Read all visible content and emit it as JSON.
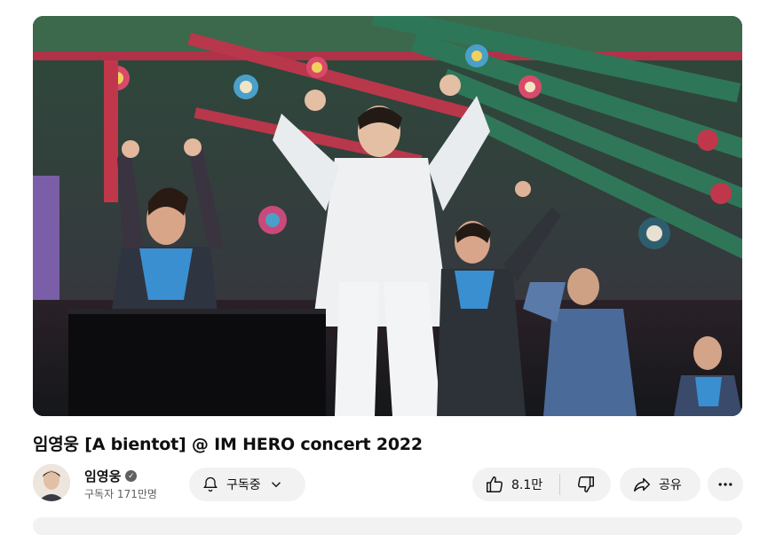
{
  "video": {
    "title": "임영웅 [A bientot] @ IM HERO concert 2022"
  },
  "channel": {
    "name": "임영웅",
    "subscribers": "구독자 171만명",
    "verified_icon": "verified-check-icon"
  },
  "actions": {
    "subscribe_label": "구독중",
    "like_count": "8.1만",
    "share_label": "공유"
  },
  "icons": {
    "bell": "bell-icon",
    "chevron": "chevron-down-icon",
    "like": "thumbs-up-icon",
    "dislike": "thumbs-down-icon",
    "share": "share-arrow-icon",
    "more": "more-horizontal-icon"
  },
  "colors": {
    "pill_bg": "#f2f2f2",
    "text": "#0f0f0f",
    "secondary_text": "#606060"
  }
}
